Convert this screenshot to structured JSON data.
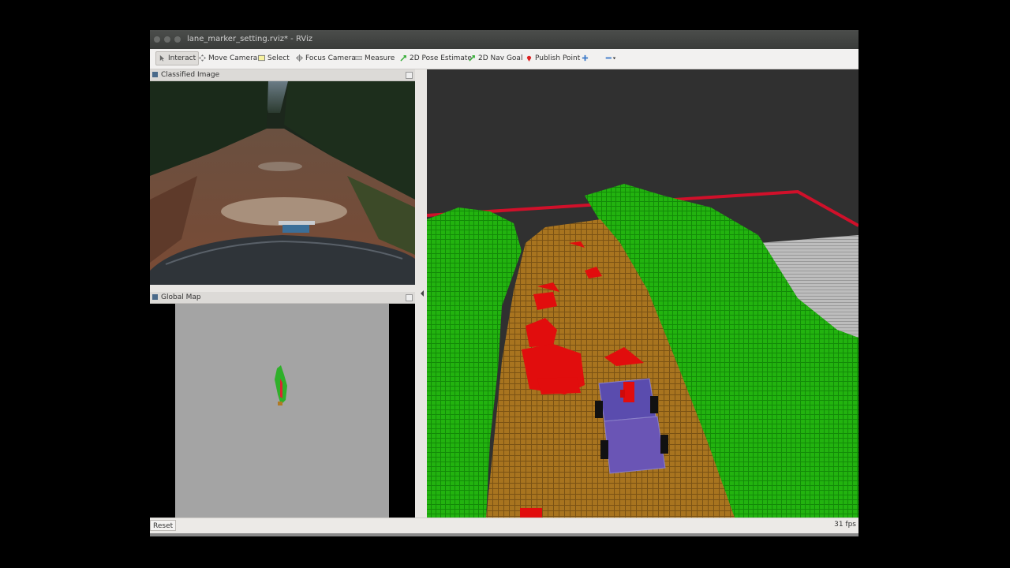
{
  "window": {
    "title": "lane_marker_setting.rviz* - RViz"
  },
  "toolbar": {
    "tools": [
      {
        "label": "Interact",
        "icon": "cursor-icon",
        "active": true
      },
      {
        "label": "Move Camera",
        "icon": "move-camera-icon"
      },
      {
        "label": "Select",
        "icon": "select-icon"
      },
      {
        "label": "Focus Camera",
        "icon": "focus-camera-icon"
      },
      {
        "label": "Measure",
        "icon": "ruler-icon"
      },
      {
        "label": "2D Pose Estimate",
        "icon": "pose-arrow-icon"
      },
      {
        "label": "2D Nav Goal",
        "icon": "nav-goal-arrow-icon"
      },
      {
        "label": "Publish Point",
        "icon": "map-pin-icon"
      }
    ],
    "extra_icons": [
      "add-tool-icon",
      "remove-tool-dropdown-icon"
    ]
  },
  "panels": {
    "classified_image": {
      "title": "Classified Image"
    },
    "global_map": {
      "title": "Global Map"
    }
  },
  "status": {
    "reset_label": "Reset",
    "fps": "31 fps"
  },
  "colors": {
    "terrain_green": "#22b30f",
    "road_brown": "#a8741f",
    "obstacle_red": "#e10d0d",
    "vehicle_purple": "#5a4cae",
    "boundary_red": "#d0102a",
    "background": "#303030"
  }
}
